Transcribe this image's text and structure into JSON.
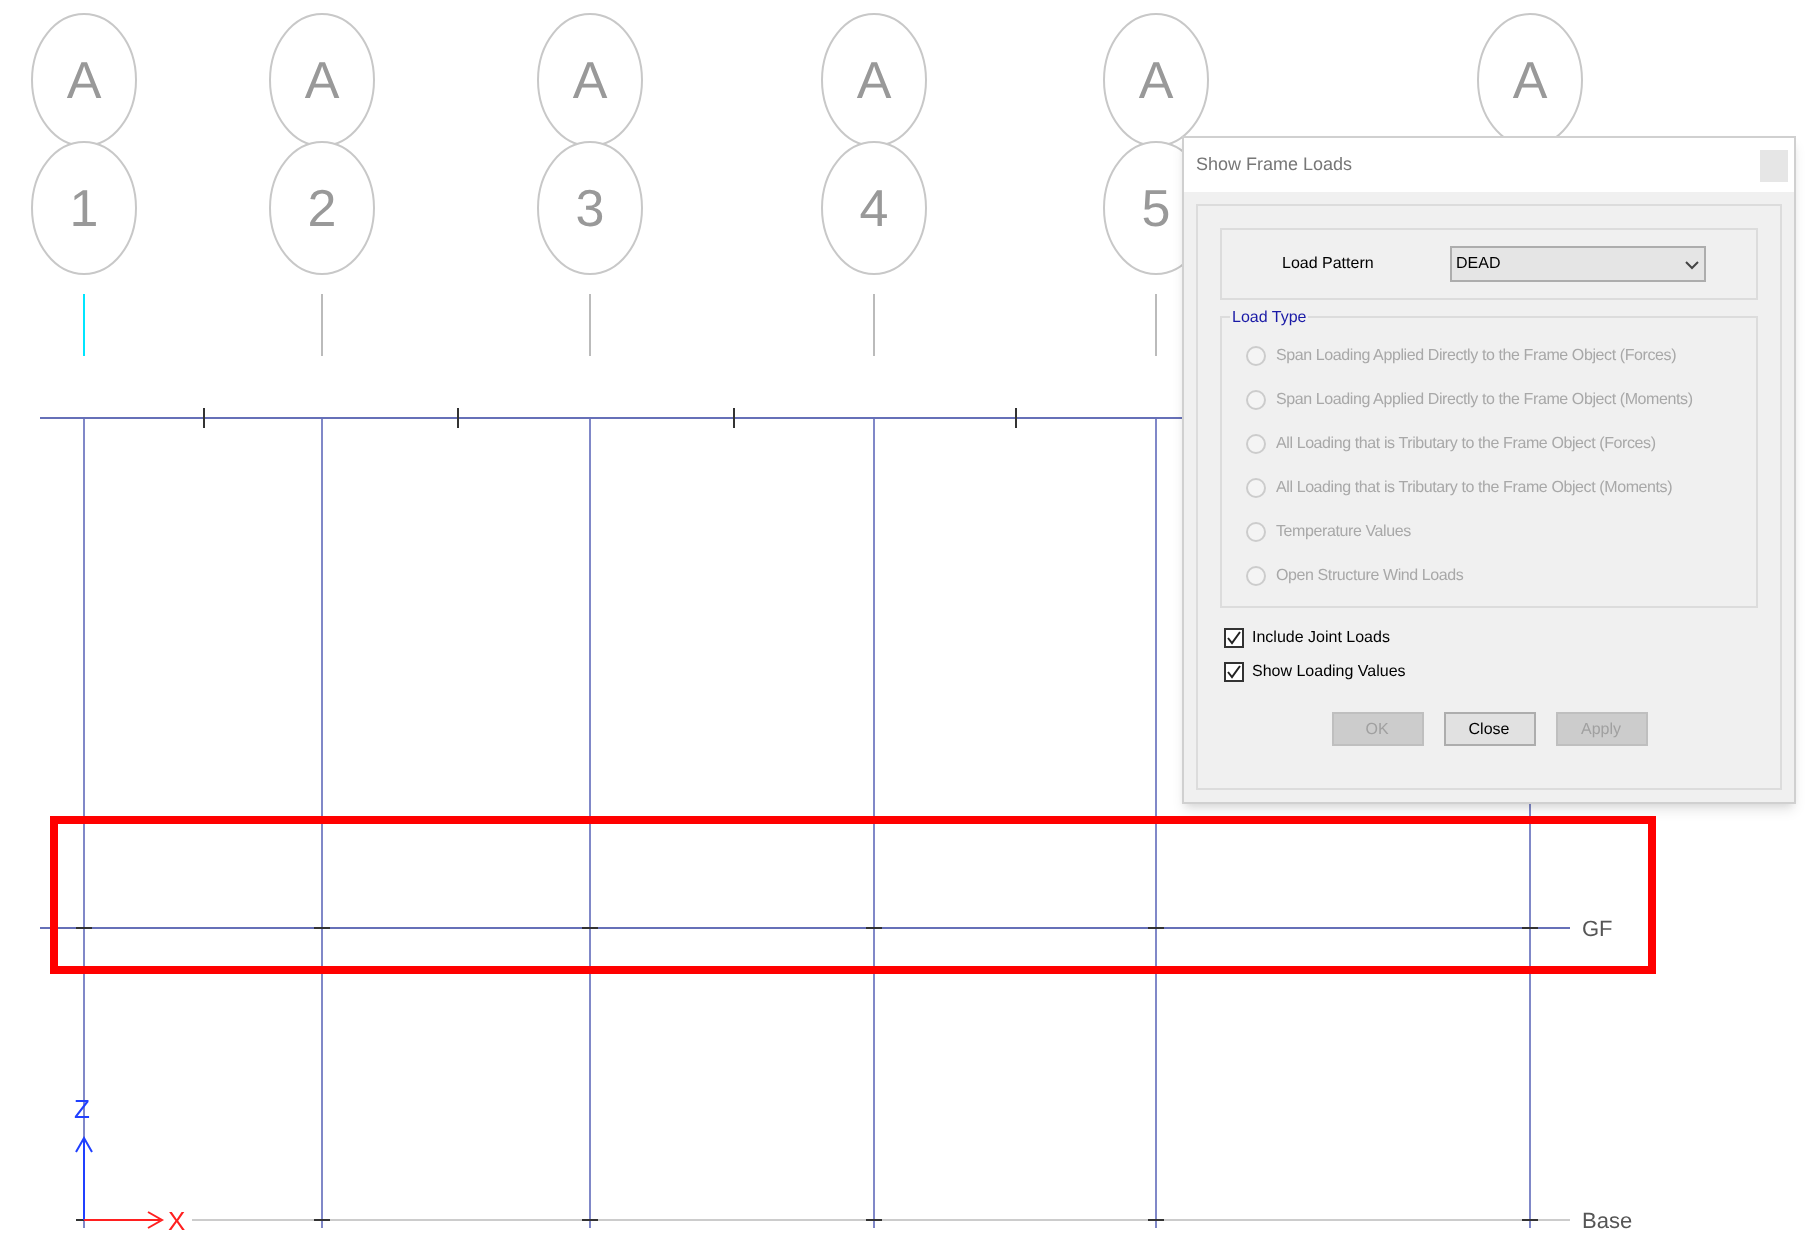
{
  "grid_lines": [
    {
      "letter": "A",
      "number": "1"
    },
    {
      "letter": "A",
      "number": "2"
    },
    {
      "letter": "A",
      "number": "3"
    },
    {
      "letter": "A",
      "number": "4"
    },
    {
      "letter": "A",
      "number": "5"
    },
    {
      "letter": "A"
    }
  ],
  "stories": [
    {
      "label": "GF",
      "highlighted": true
    },
    {
      "label": "Base",
      "highlighted": false
    }
  ],
  "axes": {
    "z": "Z",
    "x": "X"
  },
  "dialog": {
    "title": "Show Frame Loads",
    "load_pattern": {
      "label": "Load Pattern",
      "value": "DEAD"
    },
    "load_type": {
      "legend": "Load Type",
      "options": [
        {
          "label": "Span Loading Applied Directly to the Frame Object (Forces)",
          "selected": false,
          "disabled": true
        },
        {
          "label": "Span Loading Applied Directly to the Frame Object (Moments)",
          "selected": false,
          "disabled": true
        },
        {
          "label": "All Loading that is Tributary to the Frame Object (Forces)",
          "selected": false,
          "disabled": true
        },
        {
          "label": "All Loading that is Tributary to the Frame Object (Moments)",
          "selected": false,
          "disabled": true
        },
        {
          "label": "Temperature Values",
          "selected": false,
          "disabled": true
        },
        {
          "label": "Open Structure Wind Loads",
          "selected": false,
          "disabled": true
        }
      ]
    },
    "checkboxes": [
      {
        "label": "Include Joint Loads",
        "checked": true
      },
      {
        "label": "Show Loading Values",
        "checked": true
      }
    ],
    "buttons": [
      {
        "label": "OK",
        "disabled": true
      },
      {
        "label": "Close",
        "disabled": false
      },
      {
        "label": "Apply",
        "disabled": true
      }
    ]
  }
}
